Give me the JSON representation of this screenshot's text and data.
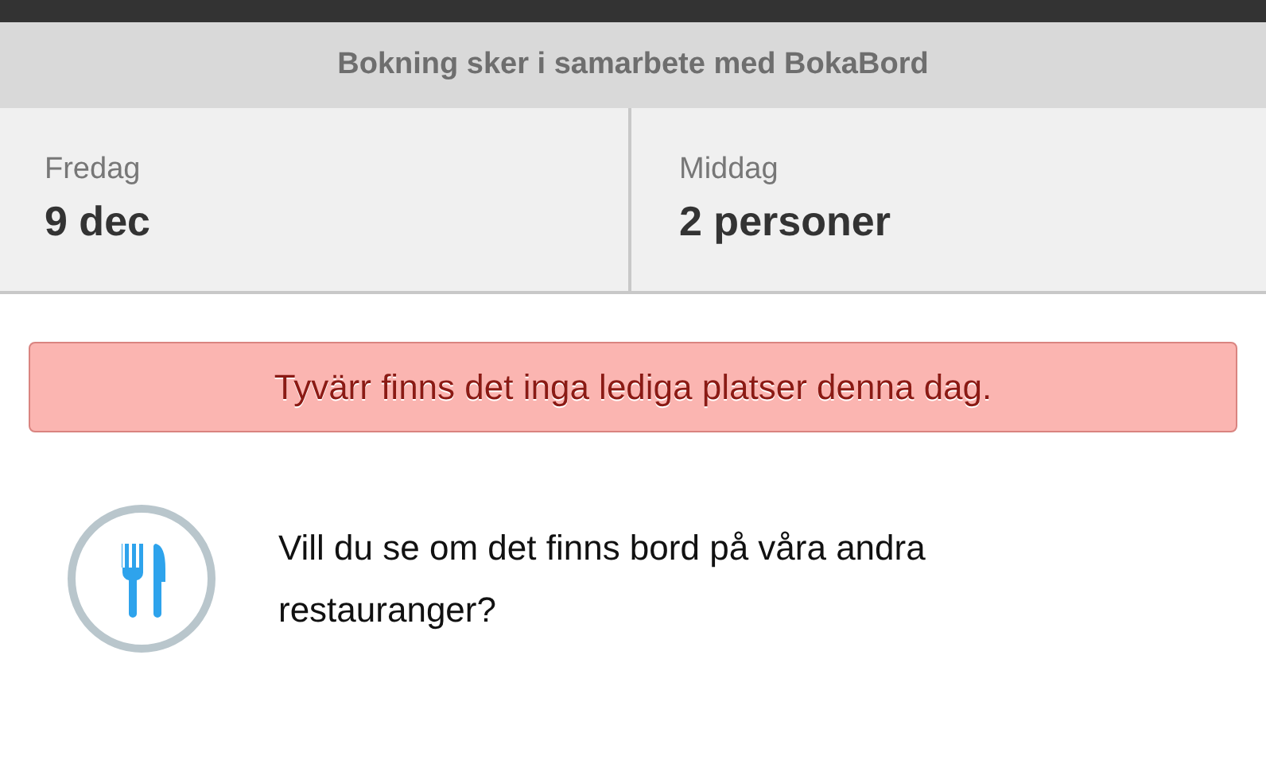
{
  "banner": {
    "text": "Bokning sker i samarbete med BokaBord"
  },
  "selectors": [
    {
      "label": "Fredag",
      "value": "9 dec"
    },
    {
      "label": "Middag",
      "value": "2 personer"
    }
  ],
  "alert": {
    "text": "Tyvärr finns det inga lediga platser denna dag."
  },
  "suggestion": {
    "text": "Vill du se om det finns bord på våra andra restauranger?"
  }
}
